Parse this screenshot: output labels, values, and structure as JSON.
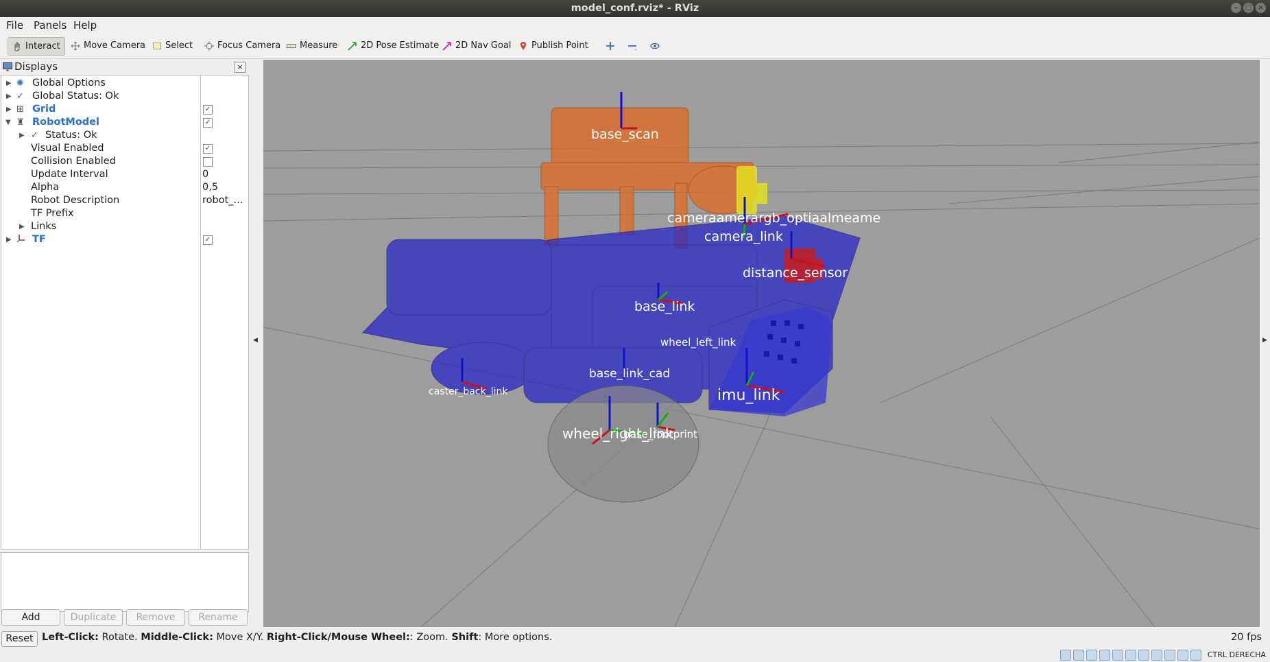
{
  "window": {
    "title": "model_conf.rviz* - RViz"
  },
  "menu": [
    "File",
    "Panels",
    "Help"
  ],
  "toolbar": {
    "tools": [
      "Interact",
      "Move Camera",
      "Select",
      "Focus Camera",
      "Measure",
      "2D Pose Estimate",
      "2D Nav Goal",
      "Publish Point"
    ],
    "active": "Interact"
  },
  "displays": {
    "title": "Displays",
    "rows": [
      {
        "name": "Global Options",
        "value": "",
        "checked": null
      },
      {
        "name": "Global Status: Ok",
        "value": "",
        "checked": null
      },
      {
        "name": "Grid",
        "value": "",
        "checked": true
      },
      {
        "name": "RobotModel",
        "value": "",
        "checked": true
      },
      {
        "name": "Status: Ok",
        "value": "",
        "checked": null
      },
      {
        "name": "Visual Enabled",
        "value": "",
        "checked": true
      },
      {
        "name": "Collision Enabled",
        "value": "",
        "checked": false
      },
      {
        "name": "Update Interval",
        "value": "0",
        "checked": null
      },
      {
        "name": "Alpha",
        "value": "0,5",
        "checked": null
      },
      {
        "name": "Robot Description",
        "value": "robot_...",
        "checked": null
      },
      {
        "name": "TF Prefix",
        "value": "",
        "checked": null
      },
      {
        "name": "Links",
        "value": "",
        "checked": null
      },
      {
        "name": "TF",
        "value": "",
        "checked": true
      }
    ],
    "buttons": [
      "Add",
      "Duplicate",
      "Remove",
      "Rename"
    ]
  },
  "viewport": {
    "frame_labels": [
      "base_scan",
      "camera_rgb_optical_frame",
      "camera_link",
      "distance_sensor",
      "base_link",
      "wheel_left_link",
      "base_link_cad",
      "caster_back_link",
      "imu_link",
      "wheel_right_link",
      "base_footprint"
    ],
    "overlap_label": "cameraamerargb_optiaalmeame",
    "colors": {
      "background": "#9d9d9d",
      "body": "#1e1ed2",
      "lidar": "#e0641e",
      "camera": "#e6e61e",
      "sensor": "#c81e1e"
    }
  },
  "status": {
    "reset": "Reset",
    "hints": [
      {
        "key": "Left-Click:",
        "text": " Rotate. "
      },
      {
        "key": "Middle-Click:",
        "text": " Move X/Y. "
      },
      {
        "key": "Right-Click/Mouse Wheel:",
        "text": ": Zoom. "
      },
      {
        "key": "Shift",
        "text": ": More options."
      }
    ],
    "fps": "20 fps"
  },
  "vm": {
    "host_key": "CTRL DERECHA"
  }
}
